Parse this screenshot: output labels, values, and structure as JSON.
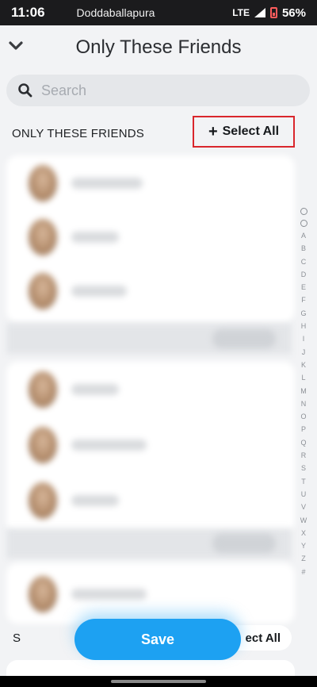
{
  "status_bar": {
    "time": "11:06",
    "carrier": "Doddaballapura",
    "network": "LTE",
    "battery": "56%"
  },
  "header": {
    "title": "Only These Friends"
  },
  "search": {
    "placeholder": "Search"
  },
  "section": {
    "label": "ONLY THESE FRIENDS",
    "select_all": "Select All"
  },
  "alphabet_index": [
    "A",
    "B",
    "C",
    "D",
    "E",
    "F",
    "G",
    "H",
    "I",
    "J",
    "K",
    "L",
    "M",
    "N",
    "O",
    "P",
    "Q",
    "R",
    "S",
    "T",
    "U",
    "V",
    "W",
    "X",
    "Y",
    "Z",
    "#"
  ],
  "bottom": {
    "letter": "S",
    "select_all": "ect All"
  },
  "save_button": {
    "label": "Save"
  },
  "colors": {
    "accent": "#1da1f2",
    "highlight_border": "#d9262c"
  }
}
